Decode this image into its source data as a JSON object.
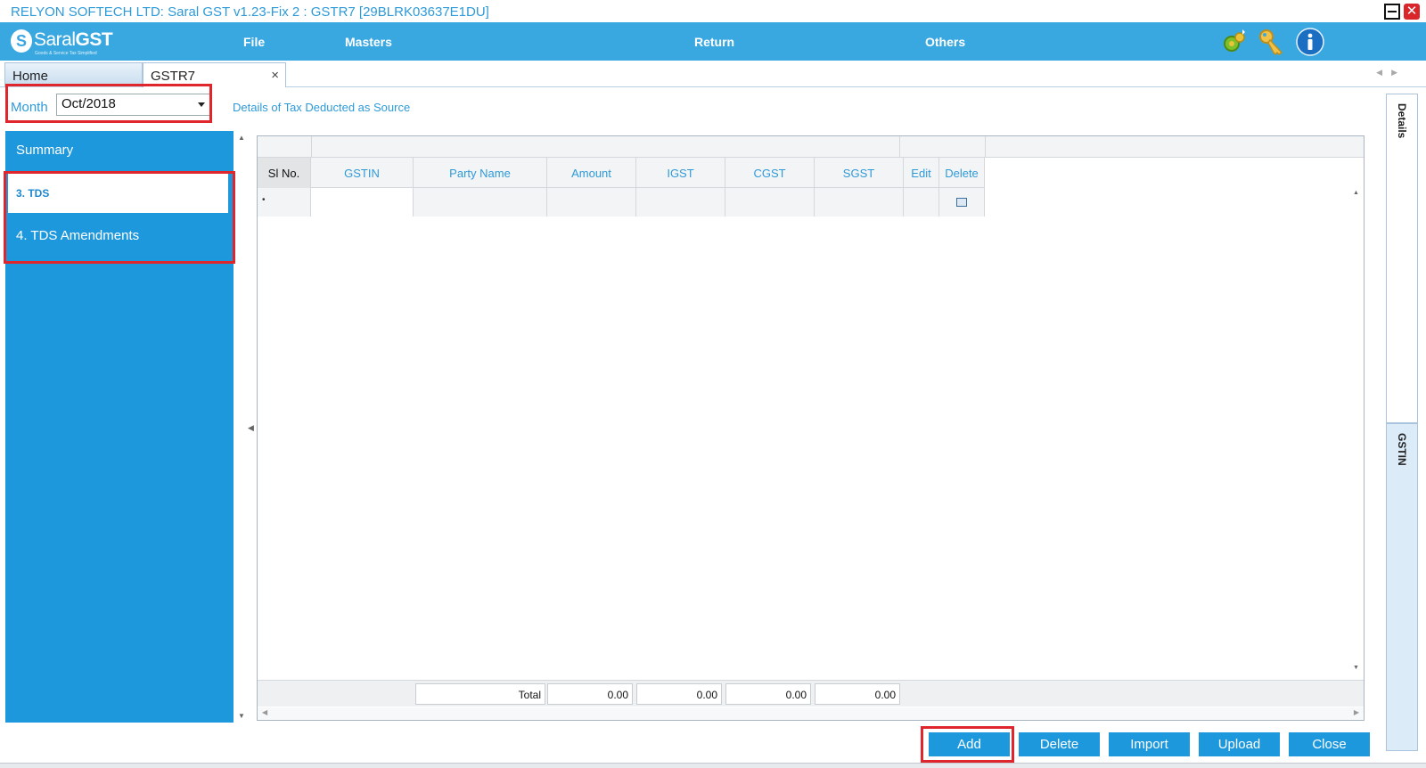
{
  "window": {
    "title": "RELYON SOFTECH LTD: Saral GST v1.23-Fix 2 : GSTR7 [29BLRK03637E1DU]",
    "close_glyph": "✕"
  },
  "logo": {
    "mark": "S",
    "brand_light": "Saral",
    "brand_bold": "GST",
    "tagline": "Goods & Service Tax Simplified"
  },
  "menu": {
    "items": [
      "File",
      "Masters",
      "Return",
      "Others"
    ]
  },
  "toolbar_icons": [
    "settings-icon",
    "key-icon",
    "info-icon"
  ],
  "tabs": [
    {
      "label": "Home"
    },
    {
      "label": "GSTR7",
      "close": "×"
    }
  ],
  "filter": {
    "month_label": "Month",
    "month_value": "Oct/2018"
  },
  "content": {
    "heading": "Details of Tax Deducted as Source"
  },
  "sidebar": {
    "items": [
      {
        "label": "Summary"
      },
      {
        "label": "3. TDS"
      },
      {
        "label": "4. TDS Amendments"
      }
    ]
  },
  "grid": {
    "columns": [
      "Sl No.",
      "GSTIN",
      "Party Name",
      "Amount",
      "IGST",
      "CGST",
      "SGST",
      "Edit",
      "Delete"
    ],
    "footer": {
      "total_label": "Total",
      "amount": "0.00",
      "igst": "0.00",
      "cgst": "0.00",
      "sgst": "0.00"
    }
  },
  "right_tabs": [
    "Details",
    "GSTIN"
  ],
  "buttons": {
    "add": "Add",
    "delete": "Delete",
    "import": "Import",
    "upload": "Upload",
    "close": "Close"
  },
  "colors": {
    "accent": "#1e98dd",
    "menu_bar": "#3aa8e0",
    "highlight": "#e0262d"
  }
}
